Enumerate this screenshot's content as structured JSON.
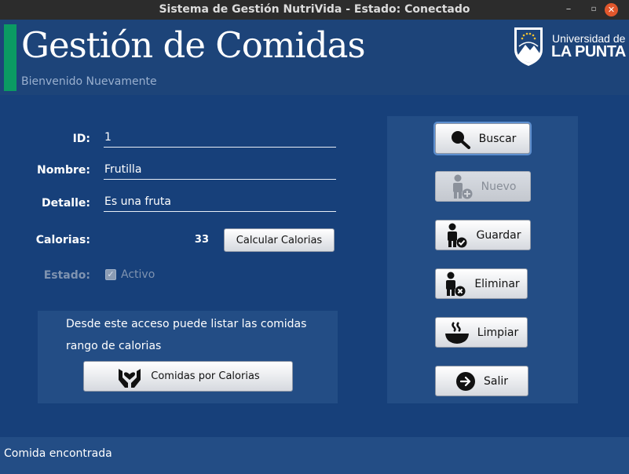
{
  "window": {
    "title": "Sistema de Gestión NutriVida - Estado: Conectado",
    "minimize": "–",
    "maximize": "▫",
    "close": "✕"
  },
  "header": {
    "title": "Gestión de Comidas",
    "subtitle": "Bienvenido Nuevamente",
    "logo_line1": "Universidad de",
    "logo_line2": "LA PUNTA",
    "accent_color": "#0b9b63"
  },
  "form": {
    "id_label": "ID:",
    "id_value": "1",
    "nombre_label": "Nombre:",
    "nombre_value": "Frutilla",
    "detalle_label": "Detalle:",
    "detalle_value": "Es una fruta",
    "calorias_label": "Calorias:",
    "calorias_value": "33",
    "calcular_button": "Calcular Calorias",
    "estado_label": "Estado:",
    "activo_label": "Activo",
    "activo_checked": true
  },
  "info": {
    "line1": "Desde este acceso puede listar las comidas",
    "line2": "rango de calorias",
    "button": "Comidas por Calorias",
    "button_icon": "hands-heart-icon"
  },
  "actions": [
    {
      "label": "Buscar",
      "icon": "search-icon",
      "enabled": true
    },
    {
      "label": "Nuevo",
      "icon": "person-add-icon",
      "enabled": false
    },
    {
      "label": "Guardar",
      "icon": "person-check-icon",
      "enabled": true
    },
    {
      "label": "Eliminar",
      "icon": "person-remove-icon",
      "enabled": true
    },
    {
      "label": "Limpiar",
      "icon": "bowl-icon",
      "enabled": true
    },
    {
      "label": "Salir",
      "icon": "exit-arrow-icon",
      "enabled": true
    }
  ],
  "status": {
    "message": "Comida encontrada"
  }
}
